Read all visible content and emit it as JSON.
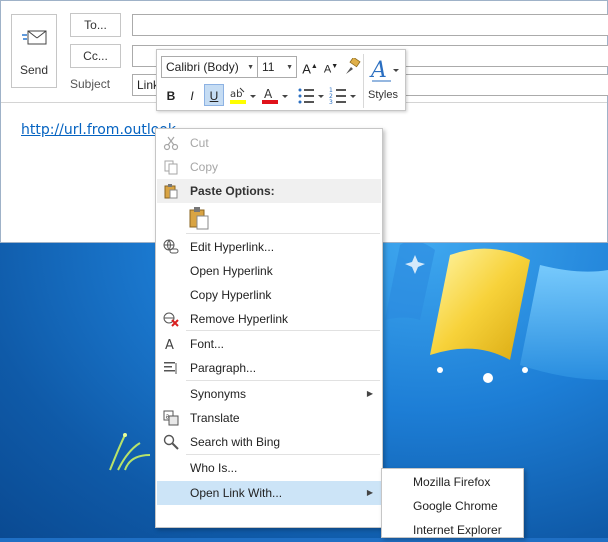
{
  "compose": {
    "send_label": "Send",
    "to_label": "To...",
    "cc_label": "Cc...",
    "subject_label": "Subject",
    "subject_value": "Link",
    "body_link": "http://url.from.outlook"
  },
  "mini_toolbar": {
    "font_name": "Calibri (Body)",
    "font_size": "11",
    "bold": "B",
    "italic": "I",
    "underline": "U",
    "grow_font": "A",
    "shrink_font": "A",
    "styles_label": "Styles"
  },
  "context_menu": {
    "cut": "Cut",
    "copy": "Copy",
    "paste_options": "Paste Options:",
    "edit_hyperlink": "Edit Hyperlink...",
    "open_hyperlink": "Open Hyperlink",
    "copy_hyperlink": "Copy Hyperlink",
    "remove_hyperlink": "Remove Hyperlink",
    "font": "Font...",
    "paragraph": "Paragraph...",
    "synonyms": "Synonyms",
    "translate": "Translate",
    "search_bing": "Search with Bing",
    "who_is": "Who Is...",
    "open_link_with": "Open Link With..."
  },
  "submenu": {
    "items": [
      "Mozilla Firefox",
      "Google Chrome",
      "Internet Explorer"
    ]
  },
  "colors": {
    "link": "#0563c1",
    "highlight": "#cce4f7",
    "desktop": "#1d7ed6"
  }
}
